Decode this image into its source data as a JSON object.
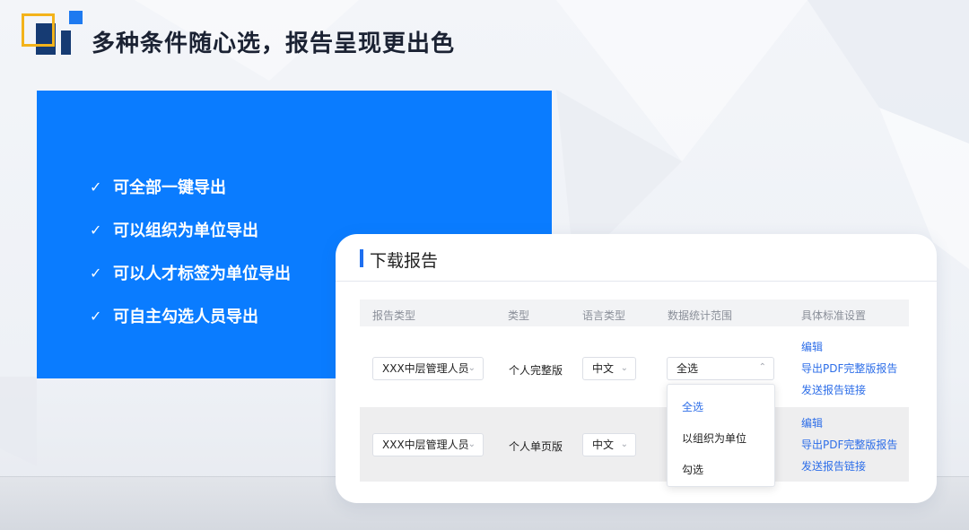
{
  "title": "多种条件随心选，报告呈现更出色",
  "colors": {
    "accent_blue": "#0a7cff",
    "navy": "#163b73",
    "gold": "#f3b31b",
    "link": "#2d6ee8"
  },
  "features": [
    "可全部一键导出",
    "可以组织为单位导出",
    "可以人才标签为单位导出",
    "可自主勾选人员导出"
  ],
  "card": {
    "title": "下载报告",
    "columns": [
      "报告类型",
      "类型",
      "语言类型",
      "数据统计范围",
      "具体标准设置"
    ],
    "rows": [
      {
        "report_type": "XXX中层管理人员",
        "type": "个人完整版",
        "language": "中文",
        "range": "全选",
        "actions": [
          "编辑",
          "导出PDF完整版报告",
          "发送报告链接"
        ]
      },
      {
        "report_type": "XXX中层管理人员",
        "type": "个人单页版",
        "language": "中文",
        "actions": [
          "编辑",
          "导出PDF完整版报告",
          "发送报告链接"
        ]
      }
    ],
    "dropdown_options": [
      "全选",
      "以组织为单位",
      "勾选"
    ]
  },
  "icons": {
    "check": "check-icon",
    "chevron_down": "chevron-down-icon",
    "chevron_up": "chevron-up-icon"
  }
}
